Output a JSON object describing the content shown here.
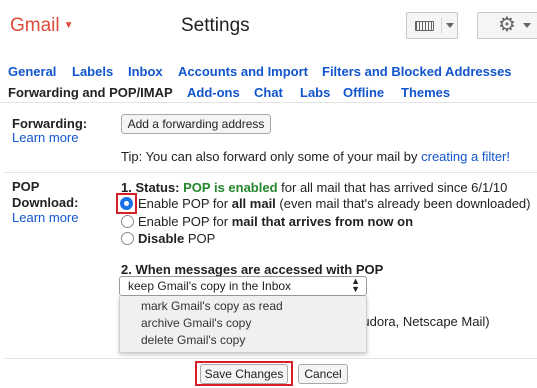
{
  "header": {
    "logo": "Gmail",
    "title": "Settings",
    "keyboard_icon": "keyboard-icon",
    "settings_icon": "gear-icon"
  },
  "tabs": {
    "row1": [
      "General",
      "Labels",
      "Inbox",
      "Accounts and Import",
      "Filters and Blocked Addresses"
    ],
    "row2": [
      "Forwarding and POP/IMAP",
      "Add-ons",
      "Chat",
      "Labs",
      "Offline",
      "Themes"
    ],
    "active": "Forwarding and POP/IMAP"
  },
  "forwarding": {
    "label": "Forwarding:",
    "learn_more": "Learn more",
    "add_button": "Add a forwarding address",
    "tip_prefix": "Tip: You can also forward only some of your mail by ",
    "tip_link": "creating a filter!"
  },
  "pop": {
    "label_line1": "POP",
    "label_line2": "Download:",
    "learn_more": "Learn more",
    "status_label": "1. Status: ",
    "status_value": "POP is enabled",
    "status_suffix": " for all mail that has arrived since 6/1/10",
    "options": [
      {
        "pre": "Enable POP for ",
        "bold": "all mail",
        "post": " (even mail that's already been downloaded)",
        "selected": true
      },
      {
        "pre": "Enable POP for ",
        "bold": "mail that arrives from now on",
        "post": "",
        "selected": false
      },
      {
        "pre": "",
        "bold": "Disable",
        "post": " POP",
        "selected": false
      }
    ],
    "when_accessed_label": "2. When messages are accessed with POP",
    "select_value": "keep Gmail's copy in the Inbox",
    "dropdown_options": [
      "mark Gmail's copy as read",
      "archive Gmail's copy",
      "delete Gmail's copy"
    ],
    "partial_text": "k, Eudora, Netscape Mail)"
  },
  "footer": {
    "save": "Save Changes",
    "cancel": "Cancel"
  },
  "colors": {
    "link": "#1155cc",
    "status": "#25862b",
    "highlight": "#d62028",
    "logo": "#dd4b39"
  }
}
